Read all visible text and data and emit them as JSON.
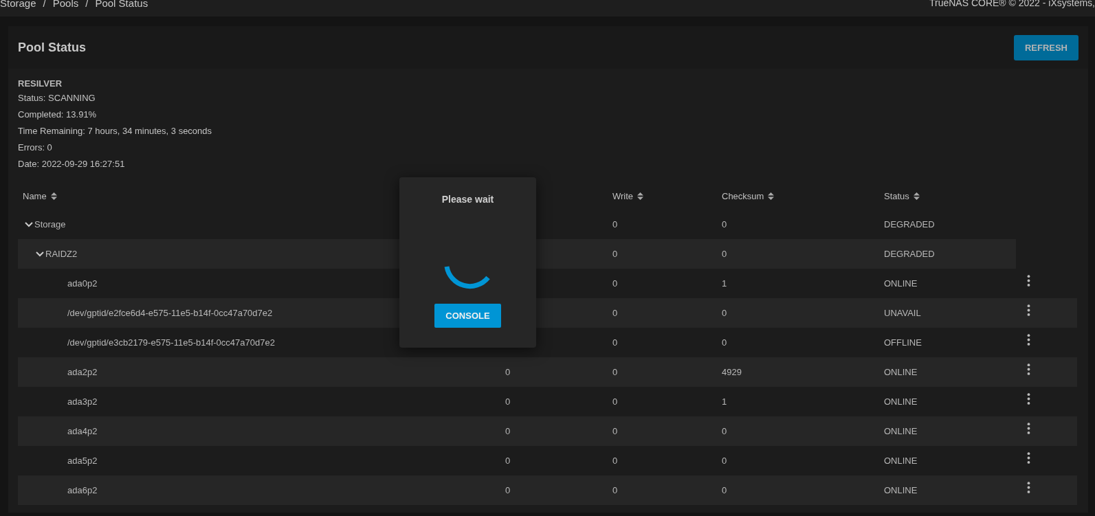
{
  "breadcrumbs": [
    "Storage",
    "Pools",
    "Pool Status"
  ],
  "breadcrumb_separator": "/",
  "copyright": "TrueNAS CORE® © 2022 - iXsystems,",
  "card": {
    "title": "Pool Status",
    "refresh_button": "REFRESH"
  },
  "resilver": {
    "title": "RESILVER",
    "lines": [
      "Status: SCANNING",
      "Completed: 13.91%",
      "Time Remaining: 7 hours, 34 minutes, 3 seconds",
      "Errors: 0",
      "Date: 2022-09-29 16:27:51"
    ]
  },
  "table": {
    "columns": [
      "Name",
      null,
      "Write",
      "Checksum",
      "Status"
    ],
    "rows": [
      {
        "kind": "pool",
        "name": "Storage",
        "expanded": true,
        "write": "0",
        "checksum": "0",
        "status": "DEGRADED",
        "children": [
          {
            "kind": "vdev",
            "name": "RAIDZ2",
            "expanded": true,
            "write": "0",
            "checksum": "0",
            "status": "DEGRADED",
            "children": [
              {
                "kind": "disk",
                "name": "ada0p2",
                "write": "0",
                "checksum": "1",
                "status": "ONLINE"
              },
              {
                "kind": "disk",
                "name": "/dev/gptid/e2fce6d4-e575-11e5-b14f-0cc47a70d7e2",
                "write": "0",
                "checksum": "0",
                "status": "UNAVAIL"
              },
              {
                "kind": "disk",
                "name": "/dev/gptid/e3cb2179-e575-11e5-b14f-0cc47a70d7e2",
                "write": "0",
                "checksum": "0",
                "status": "OFFLINE"
              },
              {
                "kind": "disk",
                "name": "ada2p2",
                "read": "0",
                "write": "0",
                "checksum": "4929",
                "status": "ONLINE"
              },
              {
                "kind": "disk",
                "name": "ada3p2",
                "read": "0",
                "write": "0",
                "checksum": "1",
                "status": "ONLINE"
              },
              {
                "kind": "disk",
                "name": "ada4p2",
                "read": "0",
                "write": "0",
                "checksum": "0",
                "status": "ONLINE"
              },
              {
                "kind": "disk",
                "name": "ada5p2",
                "read": "0",
                "write": "0",
                "checksum": "0",
                "status": "ONLINE"
              },
              {
                "kind": "disk",
                "name": "ada6p2",
                "read": "0",
                "write": "0",
                "checksum": "0",
                "status": "ONLINE"
              }
            ]
          }
        ]
      }
    ]
  },
  "dialog": {
    "title": "Please wait",
    "button": "CONSOLE"
  }
}
